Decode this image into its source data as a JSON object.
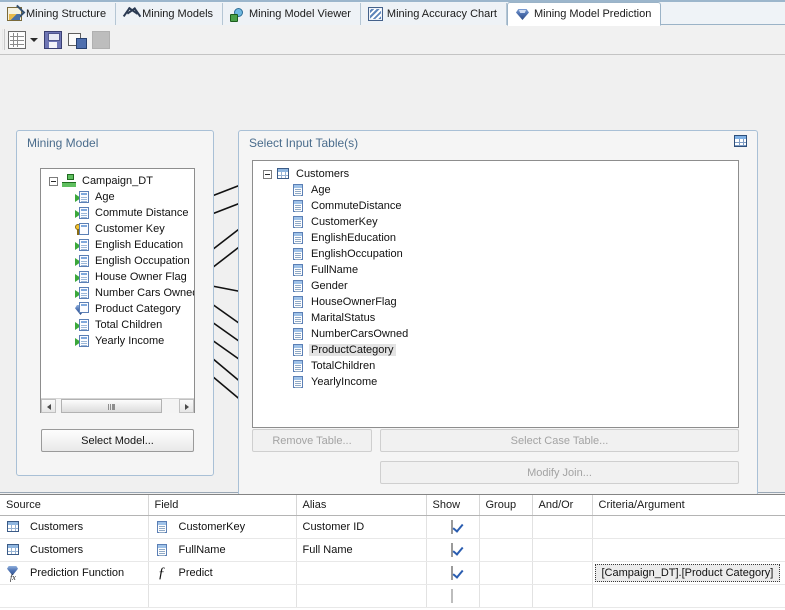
{
  "tabs": [
    {
      "label": "Mining Structure",
      "icon": "mining-structure-icon",
      "active": false
    },
    {
      "label": "Mining Models",
      "icon": "mining-models-icon",
      "active": false
    },
    {
      "label": "Mining Model Viewer",
      "icon": "mining-model-viewer-icon",
      "active": false
    },
    {
      "label": "Mining Accuracy Chart",
      "icon": "mining-accuracy-chart-icon",
      "active": false
    },
    {
      "label": "Mining Model Prediction",
      "icon": "mining-model-prediction-icon",
      "active": true
    }
  ],
  "toolbar": {
    "design_view_label": "Design View",
    "dropdown_label": "Switch view",
    "save_label": "Save Query Result",
    "export_label": "Export",
    "blank_label": "Copy"
  },
  "mining_model": {
    "title": "Mining Model",
    "root": {
      "label": "Campaign_DT",
      "icon": "mining-model-icon"
    },
    "columns": [
      {
        "label": "Age",
        "icon": "input-column-icon"
      },
      {
        "label": "Commute Distance",
        "icon": "input-column-icon"
      },
      {
        "label": "Customer Key",
        "icon": "key-column-icon"
      },
      {
        "label": "English Education",
        "icon": "input-column-icon"
      },
      {
        "label": "English Occupation",
        "icon": "input-column-icon"
      },
      {
        "label": "House Owner Flag",
        "icon": "input-column-icon"
      },
      {
        "label": "Number Cars Owned",
        "icon": "input-column-icon"
      },
      {
        "label": "Product Category",
        "icon": "predict-column-icon"
      },
      {
        "label": "Total Children",
        "icon": "input-column-icon"
      },
      {
        "label": "Yearly Income",
        "icon": "input-column-icon"
      }
    ],
    "select_model_button": "Select Model..."
  },
  "input_tables": {
    "title": "Select Input Table(s)",
    "root": {
      "label": "Customers",
      "icon": "table-icon"
    },
    "columns": [
      {
        "label": "Age",
        "selected": false
      },
      {
        "label": "CommuteDistance",
        "selected": false
      },
      {
        "label": "CustomerKey",
        "selected": false
      },
      {
        "label": "EnglishEducation",
        "selected": false
      },
      {
        "label": "EnglishOccupation",
        "selected": false
      },
      {
        "label": "FullName",
        "selected": false
      },
      {
        "label": "Gender",
        "selected": false
      },
      {
        "label": "HouseOwnerFlag",
        "selected": false
      },
      {
        "label": "MaritalStatus",
        "selected": false
      },
      {
        "label": "NumberCarsOwned",
        "selected": false
      },
      {
        "label": "ProductCategory",
        "selected": true
      },
      {
        "label": "TotalChildren",
        "selected": false
      },
      {
        "label": "YearlyIncome",
        "selected": false
      }
    ],
    "buttons": {
      "remove_table": "Remove Table...",
      "select_case_table": "Select Case Table...",
      "modify_join": "Modify Join..."
    }
  },
  "query_grid": {
    "headers": [
      "Source",
      "Field",
      "Alias",
      "Show",
      "Group",
      "And/Or",
      "Criteria/Argument"
    ],
    "rows": [
      {
        "source": "Customers",
        "source_icon": "table-icon",
        "field": "CustomerKey",
        "field_icon": "field-icon",
        "alias": "Customer ID",
        "show": true,
        "group": "",
        "and_or": "",
        "criteria": ""
      },
      {
        "source": "Customers",
        "source_icon": "table-icon",
        "field": "FullName",
        "field_icon": "field-icon",
        "alias": "Full Name",
        "show": true,
        "group": "",
        "and_or": "",
        "criteria": ""
      },
      {
        "source": "Prediction Function",
        "source_icon": "prediction-function-icon",
        "field": "Predict",
        "field_icon": "function-icon",
        "alias": "",
        "show": true,
        "group": "",
        "and_or": "",
        "criteria": "[Campaign_DT].[Product Category]"
      },
      {
        "source": "",
        "source_icon": "",
        "field": "",
        "field_icon": "",
        "alias": "",
        "show": false,
        "group": "",
        "and_or": "",
        "criteria": ""
      }
    ]
  },
  "colors": {
    "accent": "#4a6c8c",
    "group_border": "#a9c0d6",
    "selection": "#e3e3e3",
    "window_bg": "#f0f0f0",
    "tab_active_bg": "#ffffff"
  }
}
